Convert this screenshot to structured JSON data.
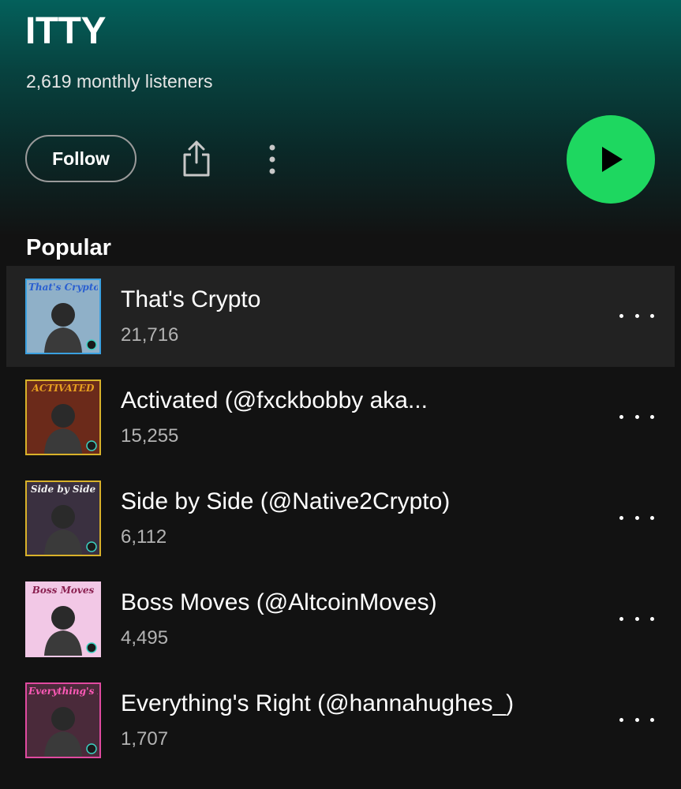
{
  "artist": {
    "name": "ITTY",
    "monthly_listeners": "2,619 monthly listeners"
  },
  "actions": {
    "follow_label": "Follow",
    "share_icon": "share-icon",
    "more_icon": "more-vertical-icon",
    "play_icon": "play-icon",
    "play_color": "#1ed760"
  },
  "popular": {
    "title": "Popular",
    "tracks": [
      {
        "title": "That's Crypto",
        "plays": "21,716",
        "cover_text": "That's Crypto",
        "cover_bg": "#8fb0c8",
        "cover_border": "#3aa0e0",
        "cover_text_color": "#2a5fd0",
        "active": true
      },
      {
        "title": "Activated (@fxckbobby aka...",
        "plays": "15,255",
        "cover_text": "ACTIVATED",
        "cover_bg": "#6b2a1a",
        "cover_border": "#d8b12a",
        "cover_text_color": "#e8a020",
        "active": false
      },
      {
        "title": "Side by Side (@Native2Crypto)",
        "plays": "6,112",
        "cover_text": "Side by Side",
        "cover_bg": "#3a3040",
        "cover_border": "#d8b12a",
        "cover_text_color": "#f0f0f0",
        "active": false
      },
      {
        "title": "Boss Moves (@AltcoinMoves)",
        "plays": "4,495",
        "cover_text": "Boss Moves",
        "cover_bg": "#f2c8e6",
        "cover_border": "#f2c8e6",
        "cover_text_color": "#8a2050",
        "active": false
      },
      {
        "title": "Everything's Right (@hannahughes_)",
        "plays": "1,707",
        "cover_text": "Everything's Right",
        "cover_bg": "#4a2a3a",
        "cover_border": "#e04aa0",
        "cover_text_color": "#ff5ab8",
        "active": false
      }
    ]
  },
  "colors": {
    "background": "#121212",
    "header_gradient_top": "#04605b",
    "secondary_text": "#b3b3b3",
    "active_row": "#222222"
  }
}
